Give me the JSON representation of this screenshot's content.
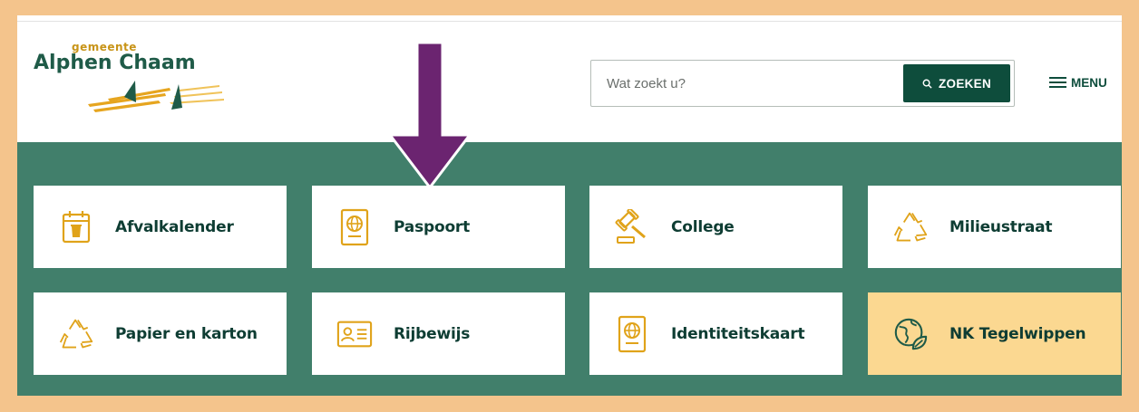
{
  "header": {
    "logo_top": "gemeente",
    "logo_main": "Alphen Chaam",
    "search_placeholder": "Wat zoekt u?",
    "search_button": "ZOEKEN",
    "menu_label": "MENU"
  },
  "tiles": [
    {
      "label": "Afvalkalender",
      "icon": "calendar-bin-icon"
    },
    {
      "label": "Paspoort",
      "icon": "passport-icon"
    },
    {
      "label": "College",
      "icon": "gavel-icon"
    },
    {
      "label": "Milieustraat",
      "icon": "recycle-icon"
    },
    {
      "label": "Papier en karton",
      "icon": "recycle-icon"
    },
    {
      "label": "Rijbewijs",
      "icon": "id-card-icon"
    },
    {
      "label": "Identiteitskaart",
      "icon": "passport-icon"
    },
    {
      "label": "NK Tegelwippen",
      "icon": "globe-leaf-icon"
    }
  ],
  "colors": {
    "border": "#f4c48c",
    "band": "#417f6b",
    "dark_green": "#0e4d3c",
    "icon_gold": "#e0a31a",
    "highlight_tile": "#fbd891",
    "arrow": "#6b2470"
  }
}
